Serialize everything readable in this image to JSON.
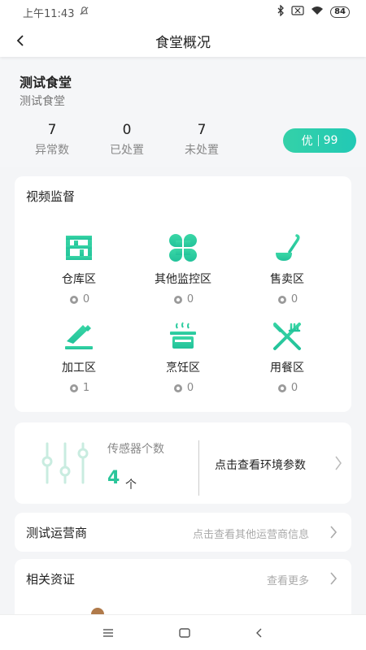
{
  "status_bar": {
    "time": "上午11:43",
    "battery": "84"
  },
  "nav": {
    "title": "食堂概况"
  },
  "canteen": {
    "name": "测试食堂",
    "subtitle": "测试食堂"
  },
  "stats": [
    {
      "value": "7",
      "label": "异常数"
    },
    {
      "value": "0",
      "label": "已处置"
    },
    {
      "value": "7",
      "label": "未处置"
    }
  ],
  "grade": {
    "label": "优",
    "score": "99"
  },
  "video": {
    "title": "视频监督",
    "zones": [
      {
        "label": "仓库区",
        "count": "0",
        "icon": "shelf-icon"
      },
      {
        "label": "其他监控区",
        "count": "0",
        "icon": "clover-icon"
      },
      {
        "label": "售卖区",
        "count": "0",
        "icon": "ladle-icon"
      },
      {
        "label": "加工区",
        "count": "1",
        "icon": "knife-icon"
      },
      {
        "label": "烹饪区",
        "count": "0",
        "icon": "pot-icon"
      },
      {
        "label": "用餐区",
        "count": "0",
        "icon": "cutlery-icon"
      }
    ]
  },
  "sensor": {
    "label": "传感器个数",
    "count": "4",
    "unit": "个",
    "link": "点击查看环境参数"
  },
  "operator": {
    "title": "测试运营商",
    "hint": "点击查看其他运营商信息"
  },
  "license": {
    "title": "相关资证",
    "hint": "查看更多"
  },
  "colors": {
    "accent": "#2bc59a",
    "gradient_start": "#34d1a8"
  }
}
